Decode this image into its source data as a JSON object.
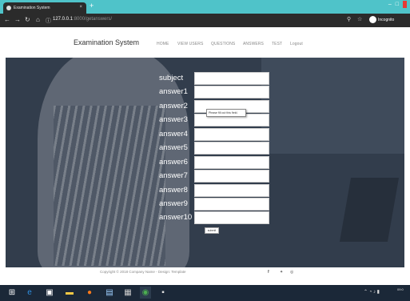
{
  "browser": {
    "tab_title": "Examination System",
    "tab_close": "×",
    "new_tab": "+",
    "minimize": "–",
    "maximize": "□",
    "url_host": "127.0.0.1",
    "url_path": ":8000/getanswers/",
    "incognito_label": "Incognito",
    "icons": [
      "back-arrow-icon",
      "forward-arrow-icon",
      "reload-icon",
      "home-icon",
      "info-icon",
      "search-icon",
      "star-icon",
      "incognito-icon"
    ]
  },
  "site": {
    "brand": "Examination System",
    "nav": [
      "HOME",
      "VIEW USERS",
      "QUESTIONS",
      "ANSWERS",
      "TEST",
      "Logout"
    ]
  },
  "form": {
    "fields": [
      {
        "label": "subject",
        "value": ""
      },
      {
        "label": "answer1",
        "value": ""
      },
      {
        "label": "answer2",
        "value": ""
      },
      {
        "label": "answer3",
        "value": ""
      },
      {
        "label": "answer4",
        "value": ""
      },
      {
        "label": "answer5",
        "value": ""
      },
      {
        "label": "answer6",
        "value": ""
      },
      {
        "label": "answer7",
        "value": ""
      },
      {
        "label": "answer8",
        "value": ""
      },
      {
        "label": "answer9",
        "value": ""
      },
      {
        "label": "answer10",
        "value": ""
      }
    ],
    "validation_message": "Please fill out this field.",
    "submit_label": "submit"
  },
  "footer": {
    "copyright": "Copyright © 2018 Company Name - Design: Template",
    "social_icons": [
      "facebook-icon",
      "twitter-icon",
      "instagram-icon"
    ]
  },
  "taskbar": {
    "clock": "09:0"
  },
  "colors": {
    "tab_strip": "#4fc3c9",
    "browser_chrome": "#2b2b2b",
    "hero_overlay": "#3b4552",
    "taskbar": "#1b2838"
  }
}
